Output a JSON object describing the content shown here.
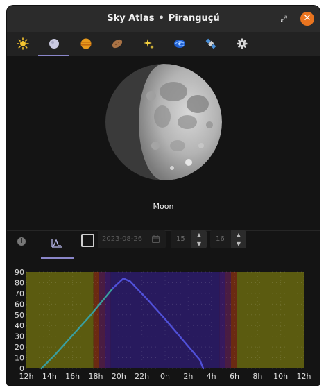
{
  "window": {
    "app_name": "Sky Atlas",
    "separator": "•",
    "location": "Piranguçú",
    "controls": {
      "minimize": "–",
      "maximize": "⤢",
      "close": "✕"
    }
  },
  "tabs": [
    {
      "id": "sun",
      "icon": "sun-icon",
      "active": false
    },
    {
      "id": "moon",
      "icon": "moon-icon",
      "active": true
    },
    {
      "id": "planet",
      "icon": "planet-icon",
      "active": false
    },
    {
      "id": "asteroid",
      "icon": "asteroid-icon",
      "active": false
    },
    {
      "id": "stars",
      "icon": "sparkles-icon",
      "active": false
    },
    {
      "id": "galaxy",
      "icon": "galaxy-icon",
      "active": false
    },
    {
      "id": "satellite",
      "icon": "satellite-icon",
      "active": false
    },
    {
      "id": "settings",
      "icon": "gear-icon",
      "active": false
    }
  ],
  "object": {
    "name": "Moon"
  },
  "controls": {
    "info_icon": "i",
    "graph_tab": "graph-icon",
    "show_checkbox_checked": false,
    "date_placeholder": "2023-08-26",
    "hour_value": "15",
    "minute_value": "16",
    "spin_up": "▲",
    "spin_down": "▼"
  },
  "chart_data": {
    "type": "line",
    "title": "",
    "xlabel": "",
    "ylabel": "",
    "ylim": [
      0,
      90
    ],
    "yticks": [
      0,
      10,
      20,
      30,
      40,
      50,
      60,
      70,
      80,
      90
    ],
    "xticks": [
      "12h",
      "14h",
      "16h",
      "18h",
      "20h",
      "22h",
      "0h",
      "2h",
      "4h",
      "6h",
      "8h",
      "10h",
      "12h"
    ],
    "x_hours_from_noon": [
      0,
      24
    ],
    "series": [
      {
        "x": [
          1.3,
          2.5,
          4.0,
          5.5,
          6.5,
          7.5,
          8.0,
          8.4,
          9.0,
          10.5,
          12.0,
          13.5,
          15.0,
          15.3
        ],
        "y": [
          0,
          13,
          31,
          49,
          62,
          75,
          80,
          84,
          81,
          64,
          46,
          27,
          8,
          0
        ]
      }
    ],
    "line_colors": {
      "day": "#3a9e9e",
      "night": "#5050d8"
    },
    "background_bands": [
      {
        "from": 0,
        "to": 5.8,
        "color": "#5b5b10"
      },
      {
        "from": 5.8,
        "to": 6.3,
        "color": "#6b2a12"
      },
      {
        "from": 6.3,
        "to": 6.8,
        "color": "#4a1c42"
      },
      {
        "from": 6.8,
        "to": 7.3,
        "color": "#37195d"
      },
      {
        "from": 7.3,
        "to": 16.7,
        "color": "#281a5e"
      },
      {
        "from": 16.7,
        "to": 17.2,
        "color": "#37195d"
      },
      {
        "from": 17.2,
        "to": 17.7,
        "color": "#4a1c42"
      },
      {
        "from": 17.7,
        "to": 18.2,
        "color": "#6b2a12"
      },
      {
        "from": 18.2,
        "to": 24,
        "color": "#5b5b10"
      }
    ],
    "grid": true
  }
}
